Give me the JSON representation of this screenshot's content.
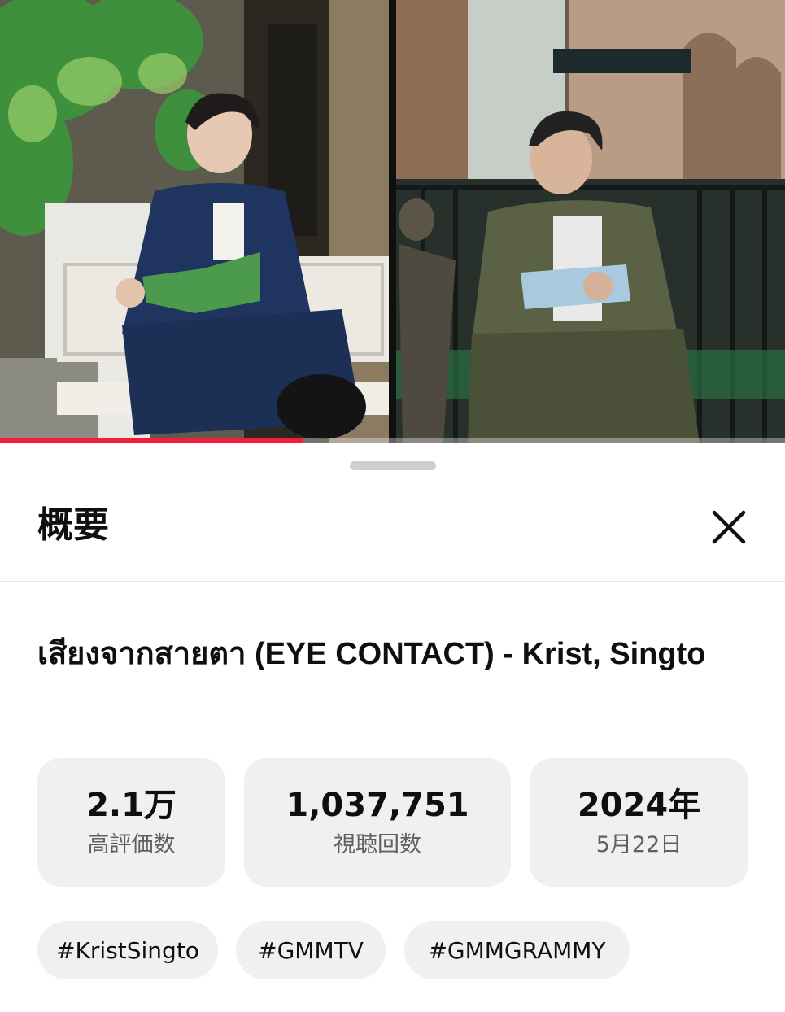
{
  "player": {
    "progress_fraction": 0.385,
    "progress_color": "#f21d3c"
  },
  "sheet": {
    "title": "概要",
    "close_icon": "close-icon"
  },
  "video": {
    "title": "เสียงจากสายตา (EYE CONTACT) - Krist, Singto"
  },
  "stats": {
    "likes": {
      "value": "2.1万",
      "label": "高評価数"
    },
    "views": {
      "value": "1,037,751",
      "label": "視聴回数"
    },
    "date": {
      "value": "2024年",
      "label": "5月22日"
    }
  },
  "hashtags": [
    "#KristSingto",
    "#GMMTV",
    "#GMMGRAMMY"
  ]
}
